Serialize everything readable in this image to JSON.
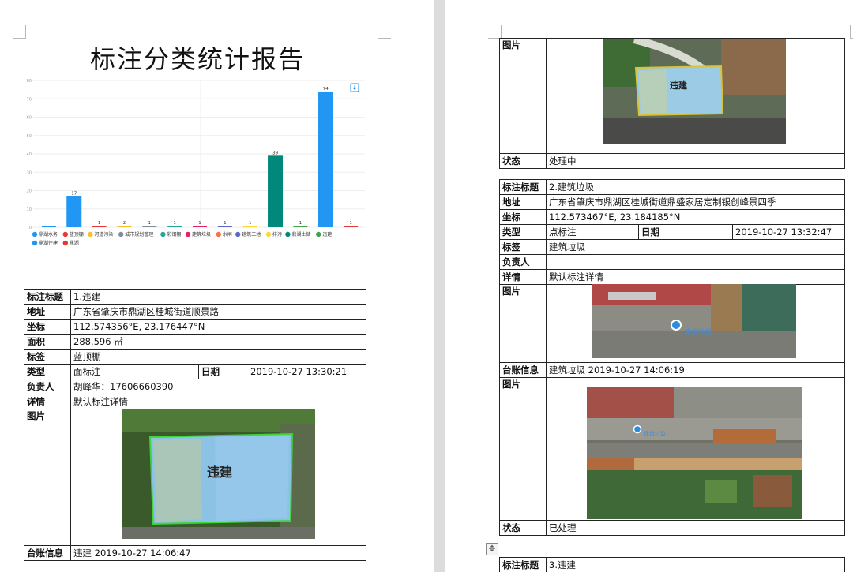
{
  "report_title": "标注分类统计报告",
  "chart_data": {
    "type": "bar",
    "categories": [
      "鼎湖水务",
      "蓝顶棚",
      "河道污染",
      "城市规划管理",
      "彩钢棚",
      "建筑垃圾",
      "水闸",
      "建筑工地",
      "排污",
      "鼎湖土储",
      "违建",
      "鼎湖住建",
      "鼎湖"
    ],
    "values": [
      0,
      17,
      1,
      2,
      1,
      1,
      1,
      1,
      1,
      39,
      1,
      74,
      1
    ],
    "colors": [
      "#2196f3",
      "#2196f3",
      "#e53935",
      "#fbc02d",
      "#7b8f9f",
      "#26a69a",
      "#e91e63",
      "#5c6bc0",
      "#fdd835",
      "#00897b",
      "#43a047",
      "#2196f3",
      "#e53935"
    ],
    "value_labels": [
      "",
      "17",
      "1",
      "2",
      "1",
      "1",
      "1",
      "1",
      "1",
      "39",
      "1",
      "74",
      "1"
    ],
    "y_ticks": [
      "80",
      "70",
      "60",
      "50",
      "40",
      "30",
      "20",
      "10",
      "0"
    ],
    "ylim": [
      0,
      80
    ],
    "legend": [
      {
        "name": "鼎湖水务",
        "color": "#2196f3"
      },
      {
        "name": "蓝顶棚",
        "color": "#e53935"
      },
      {
        "name": "河道污染",
        "color": "#fbc02d"
      },
      {
        "name": "城市规划管理",
        "color": "#7b8f9f"
      },
      {
        "name": "彩钢棚",
        "color": "#26a69a"
      },
      {
        "name": "建筑垃圾",
        "color": "#e91e63"
      },
      {
        "name": "水闸",
        "color": "#ff7043"
      },
      {
        "name": "建筑工地",
        "color": "#5c6bc0"
      },
      {
        "name": "排污",
        "color": "#fdd835"
      },
      {
        "name": "鼎湖土储",
        "color": "#00897b"
      },
      {
        "name": "违建",
        "color": "#43a047"
      },
      {
        "name": "鼎湖住建",
        "color": "#2196f3"
      },
      {
        "name": "鼎湖",
        "color": "#e53935"
      }
    ],
    "legend_placement": "bottom",
    "grid": true
  },
  "labels": {
    "title": "标注标题",
    "address": "地址",
    "coords": "坐标",
    "area": "面积",
    "tag": "标签",
    "type": "类型",
    "date": "日期",
    "owner": "负责人",
    "detail": "详情",
    "image": "图片",
    "ledger": "台账信息",
    "status": "状态"
  },
  "record1": {
    "title": "1.违建",
    "address": "广东省肇庆市鼎湖区桂城街道顺景路",
    "coords": "112.574356°E, 23.176447°N",
    "area": "288.596 ㎡",
    "tag": "蓝顶棚",
    "type": "面标注",
    "date": "2019-10-27 13:30:21",
    "owner": "胡峰华：17606660390",
    "detail": "默认标注详情",
    "image_overlay": "违建",
    "ledger": "违建 2019-10-27 14:06:47"
  },
  "record_prev": {
    "image_overlay": "违建",
    "status": "处理中"
  },
  "record2": {
    "title": "2.建筑垃圾",
    "address": "广东省肇庆市鼎湖区桂城街道鼎盛家居定制银创峰景四季",
    "coords": "112.573467°E, 23.184185°N",
    "type": "点标注",
    "date": "2019-10-27 13:32:47",
    "tag": "建筑垃圾",
    "owner": "",
    "detail": "默认标注详情",
    "image_overlay": "建筑垃圾",
    "ledger": "建筑垃圾 2019-10-27 14:06:19",
    "ledger_image_overlay": "建筑垃圾",
    "status": "已处理"
  },
  "record3": {
    "title": "3.违建"
  },
  "icons": {
    "download": "download-icon",
    "move": "move-handle-icon"
  }
}
